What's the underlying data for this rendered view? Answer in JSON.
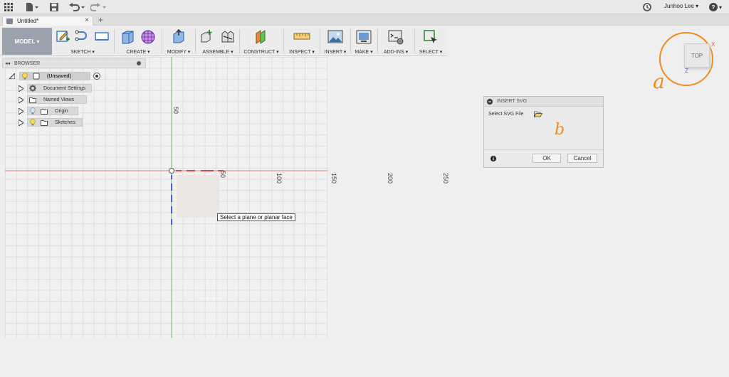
{
  "appbar": {
    "user_name": "Junhoo Lee",
    "user_caret": "▾",
    "help_caret": "▾"
  },
  "tab": {
    "title": "Untitled*",
    "close": "×",
    "new_tab": "+"
  },
  "toolbar": {
    "mode_label": "MODEL ▾",
    "groups": [
      {
        "label": "SKETCH ▾"
      },
      {
        "label": "CREATE ▾"
      },
      {
        "label": "MODIFY ▾"
      },
      {
        "label": "ASSEMBLE ▾"
      },
      {
        "label": "CONSTRUCT ▾"
      },
      {
        "label": "INSPECT ▾"
      },
      {
        "label": "INSERT ▾"
      },
      {
        "label": "MAKE ▾"
      },
      {
        "label": "ADD-INS ▾"
      },
      {
        "label": "SELECT ▾"
      }
    ]
  },
  "browser": {
    "title": "BROWSER",
    "root": "(Unsaved)",
    "items": [
      {
        "label": "Document Settings"
      },
      {
        "label": "Named Views"
      },
      {
        "label": "Origin"
      },
      {
        "label": "Sketches"
      }
    ]
  },
  "canvas": {
    "axis_labels": [
      "50",
      "50",
      "100",
      "150",
      "200",
      "250"
    ],
    "tooltip": "Select a plane or planar face"
  },
  "dialog": {
    "title": "INSERT SVG",
    "field_label": "Select SVG File",
    "ok": "OK",
    "cancel": "Cancel"
  },
  "viewcube": {
    "face": "TOP",
    "x_axis": "X",
    "z_axis": "Z"
  },
  "annotations": {
    "a": "a",
    "b": "b"
  },
  "colors": {
    "annotation": "#f28a1c",
    "x_axis": "#e05555",
    "y_axis": "#55b055",
    "z_axis": "#5a5ad6"
  }
}
